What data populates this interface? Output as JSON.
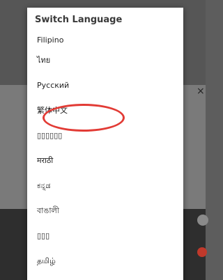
{
  "dialog": {
    "title": "Switch Language",
    "languages": [
      "Filipino",
      "ไทย",
      "Русский",
      "繁体中文",
      "▯▯▯▯▯▯",
      "मराठी",
      "ಕನ್ನಡ",
      "বাঙালী",
      "▯▯▯",
      "தமிழ்"
    ]
  },
  "background": {
    "close_glyph": "×"
  },
  "colors": {
    "highlight_ring": "#e23b35",
    "dialog_bg": "#ffffff",
    "backdrop": "#5d5d5d"
  }
}
